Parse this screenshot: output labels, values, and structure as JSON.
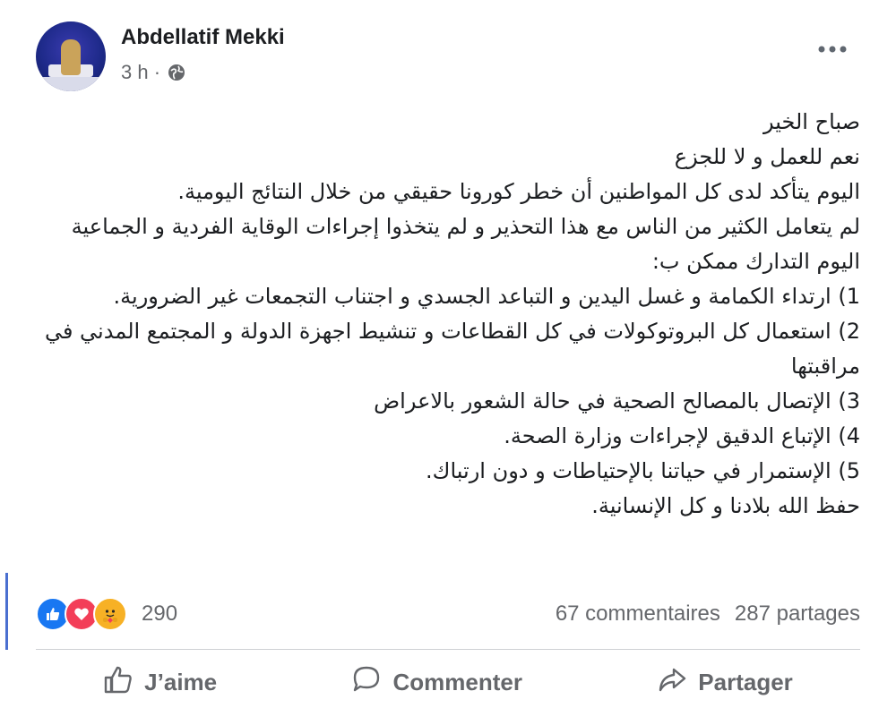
{
  "post": {
    "author": "Abdellatif Mekki",
    "time": "3 h ·",
    "lines": [
      "صباح الخير",
      "نعم للعمل و لا للجزع",
      "اليوم يتأكد لدى كل المواطنين أن خطر كورونا حقيقي من خلال النتائج اليومية.",
      "لم يتعامل الكثير من الناس مع هذا التحذير  و لم يتخذوا إجراءات الوقاية الفردية و الجماعية",
      "اليوم التدارك ممكن ب:",
      "1) ارتداء الكمامة و غسل اليدين و التباعد الجسدي و اجتناب التجمعات غير الضرورية.",
      "2) استعمال كل البروتوكولات في كل القطاعات و تنشيط اجهزة الدولة و المجتمع المدني في مراقبتها",
      "3) الإتصال بالمصالح الصحية في حالة الشعور بالاعراض",
      "4) الإتباع الدقيق لإجراءات وزارة الصحة.",
      "5) الإستمرار في حياتنا بالإحتياطات و دون ارتباك.",
      "حفظ الله بلادنا و كل الإنسانية."
    ]
  },
  "reactions": {
    "icons": [
      "like-icon",
      "love-icon",
      "care-icon"
    ],
    "count": "290",
    "comments": "67 commentaires",
    "shares": "287 partages"
  },
  "actions": {
    "like": "J’aime",
    "comment": "Commenter",
    "share": "Partager"
  },
  "colors": {
    "like": "#1877f2",
    "love": "#f33e58",
    "care": "#f7b125",
    "secondary_text": "#65676b"
  }
}
